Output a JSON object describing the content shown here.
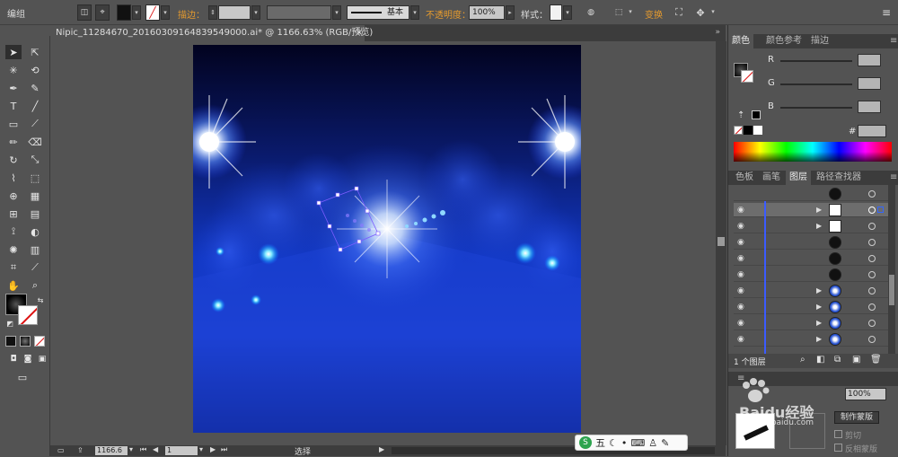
{
  "menu": {
    "edit_group": "编组"
  },
  "control_bar": {
    "stroke_label": "描边：",
    "stroke_style": "基本",
    "opacity_label": "不透明度：",
    "opacity_value": "100%",
    "style_label": "样式：",
    "transform_label": "变换"
  },
  "document": {
    "tab_title": "Nipic_11284670_20160309164839549000.ai* @ 1166.63% (RGB/预览)",
    "close_glyph": "×"
  },
  "status": {
    "zoom": "1166.6",
    "page": "1",
    "tool": "选择"
  },
  "color_panel": {
    "tabs": [
      "颜色",
      "颜色参考",
      "描边"
    ],
    "channels": [
      "R",
      "G",
      "B"
    ],
    "hex_label": "#"
  },
  "layers_panel": {
    "tabs": [
      "色板",
      "画笔",
      "图层",
      "路径查找器"
    ],
    "count_label": "1 个图层"
  },
  "transparency_panel": {
    "opacity_value": "100%",
    "make_mask_label": "制作蒙版",
    "clip_label": "剪切",
    "invert_label": "反相蒙版"
  },
  "ime": {
    "label": "五"
  },
  "watermark": {
    "text": "Baidu经验",
    "url_text": "jingyan.baidu.com"
  },
  "colors": {
    "ui_bg": "#535353",
    "accent_orange": "#e69b2e",
    "artboard_deep": "#02031f",
    "artboard_blue": "#1a3fd6",
    "selection": "#7b5cff"
  }
}
